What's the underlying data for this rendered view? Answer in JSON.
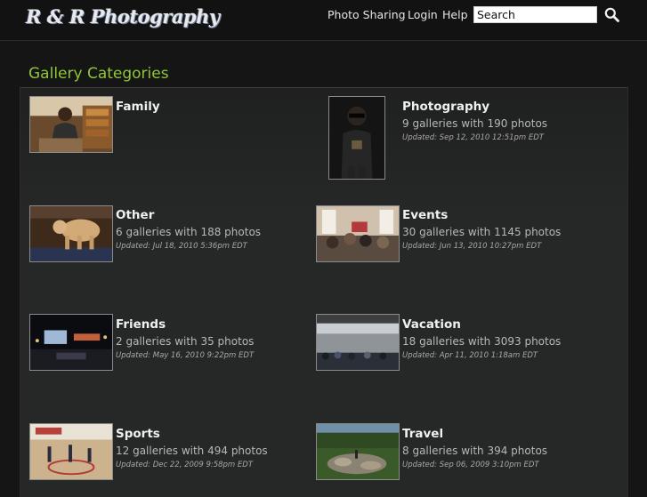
{
  "header": {
    "logo": "R & R Photography",
    "nav": [
      "Photo Sharing",
      "Login",
      "Help"
    ],
    "search": {
      "value": "",
      "placeholder": "Search"
    }
  },
  "section": {
    "title": "Gallery Categories"
  },
  "categories": [
    {
      "name": "Family",
      "count": "",
      "updated": ""
    },
    {
      "name": "Photography",
      "count": "9 galleries with 190 photos",
      "updated": "Updated: Sep 12, 2010 12:51pm EDT"
    },
    {
      "name": "Other",
      "count": "6 galleries with 188 photos",
      "updated": "Updated: Jul 18, 2010 5:36pm EDT"
    },
    {
      "name": "Events",
      "count": "30 galleries with 1145 photos",
      "updated": "Updated: Jun 13, 2010 10:27pm EDT"
    },
    {
      "name": "Friends",
      "count": "2 galleries with 35 photos",
      "updated": "Updated: May 16, 2010 9:22pm EDT"
    },
    {
      "name": "Vacation",
      "count": "18 galleries with 3093 photos",
      "updated": "Updated: Apr 11, 2010 1:18am EDT"
    },
    {
      "name": "Sports",
      "count": "12 galleries with 494 photos",
      "updated": "Updated: Dec 22, 2009 9:58pm EDT"
    },
    {
      "name": "Travel",
      "count": "8 galleries with 394 photos",
      "updated": "Updated: Sep 06, 2009 3:10pm EDT"
    }
  ]
}
